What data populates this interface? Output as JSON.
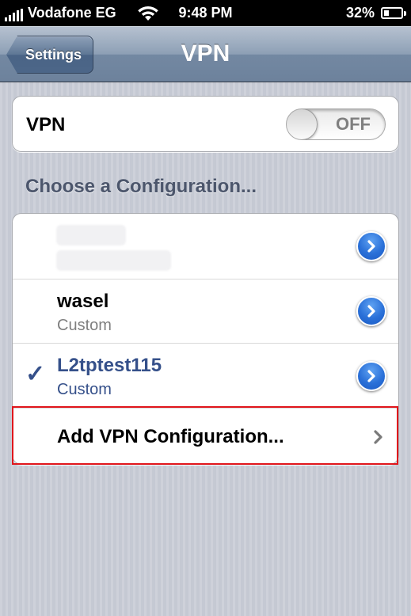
{
  "status_bar": {
    "carrier": "Vodafone EG",
    "time": "9:48 PM",
    "battery": "32%",
    "battery_level": 0.32,
    "signal_icon": "signal-bars-icon",
    "wifi_icon": "wifi-icon",
    "battery_icon": "battery-icon"
  },
  "nav": {
    "back_label": "Settings",
    "title": "VPN"
  },
  "vpn": {
    "label": "VPN",
    "toggle_state": "OFF"
  },
  "config": {
    "section_header": "Choose a Configuration...",
    "items": [
      {
        "title": "",
        "subtitle": "",
        "selected": false,
        "redacted": true
      },
      {
        "title": "wasel",
        "subtitle": "Custom",
        "selected": false
      },
      {
        "title": "L2tptest115",
        "subtitle": "Custom",
        "selected": true
      }
    ],
    "checkmark": "✓",
    "add_label": "Add VPN Configuration..."
  },
  "colors": {
    "nav_bar": "#7f93ad",
    "selected_text": "#35508a",
    "detail_button": "#2a70d8",
    "highlight": "#e0161c"
  }
}
